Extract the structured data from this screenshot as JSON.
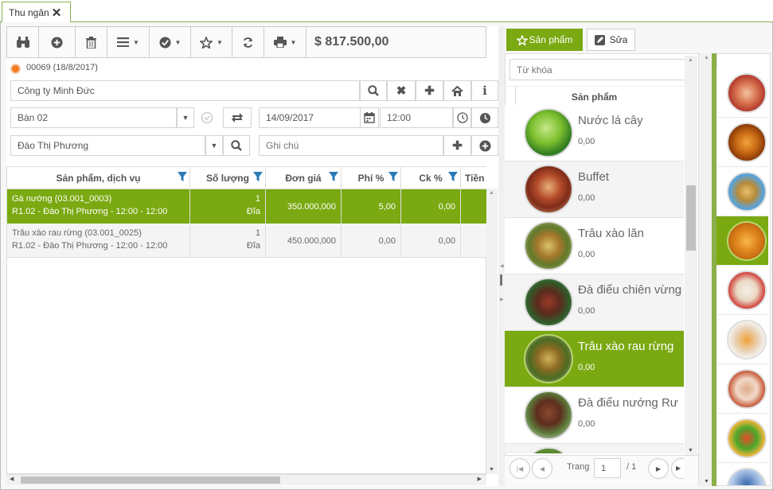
{
  "tab": {
    "label": "Thu ngân"
  },
  "toolbar": {
    "total": "$ 817.500,00"
  },
  "order": {
    "code": "00069 (18/8/2017)"
  },
  "form": {
    "customer": "Công ty Minh Đức",
    "table": "Bàn 02",
    "date": "14/09/2017",
    "time": "12:00",
    "staff": "Đào Thị Phương",
    "note_placeholder": "Ghi chú"
  },
  "grid": {
    "headers": [
      "Sản phẩm, dịch vụ",
      "Số lượng",
      "Đơn giá",
      "Phí %",
      "Ck %",
      "Tiền"
    ],
    "rows": [
      {
        "name": "Gà nướng (03.001_0003)",
        "detail": "R1.02 - Đào Thị Phương - 12:00 - 12:00",
        "qty": "1",
        "unit": "Đĩa",
        "price": "350.000,000",
        "fee": "5,00",
        "discount": "0,00"
      },
      {
        "name": "Trâu xào rau rừng (03.001_0025)",
        "detail": "R1.02 - Đào Thị Phương - 12:00 - 12:00",
        "qty": "1",
        "unit": "Đĩa",
        "price": "450.000,000",
        "fee": "0,00",
        "discount": "0,00"
      }
    ]
  },
  "panel": {
    "products_tab": "Sản phẩm",
    "edit_tab": "Sửa",
    "search_placeholder": "Từ khóa",
    "list_header": "Sản phẩm",
    "products": [
      {
        "name": "Nước lá cây",
        "price": "0,00"
      },
      {
        "name": "Buffet",
        "price": "0,00"
      },
      {
        "name": "Trâu xào lăn",
        "price": "0,00"
      },
      {
        "name": "Đà điểu chiên vừng",
        "price": "0,00"
      },
      {
        "name": "Trâu xào rau rừng",
        "price": "0,00"
      },
      {
        "name": "Đà điểu nướng Rư",
        "price": "0,00"
      }
    ],
    "pager": {
      "label": "Trang",
      "page": "1",
      "total": "/ 1"
    }
  },
  "colors": {
    "accent": "#7aa911",
    "filter": "#2a7ab8"
  }
}
